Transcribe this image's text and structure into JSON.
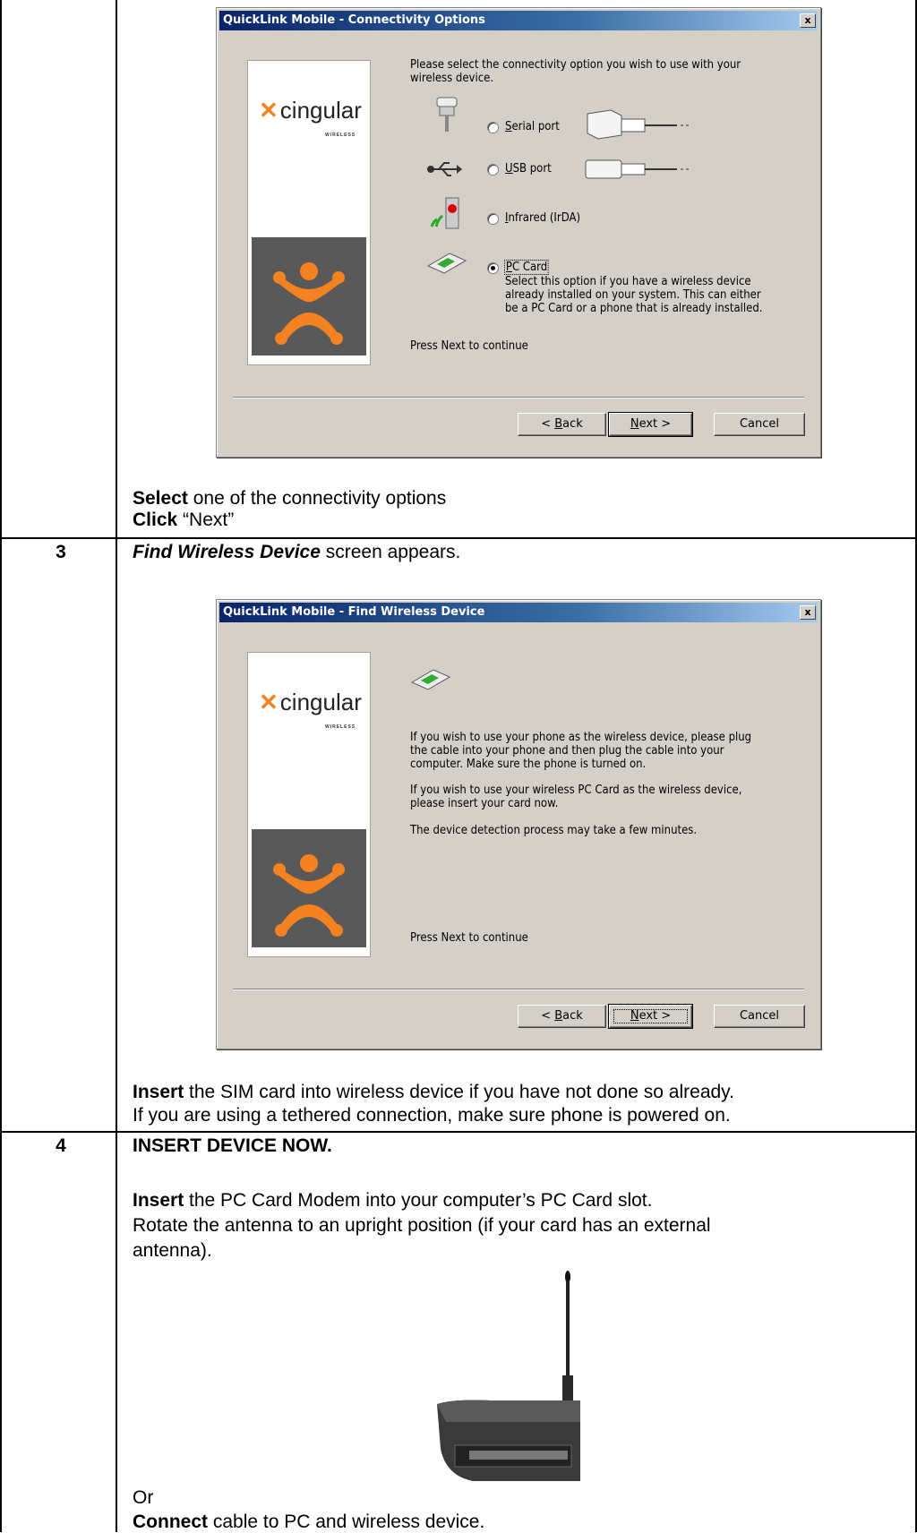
{
  "dialog1": {
    "title": "QuickLink Mobile - Connectivity Options",
    "close": "x",
    "brand": "cingular",
    "brand_sub": "WIRELESS",
    "instruction_line1": "Please select the connectivity option you wish to use with your",
    "instruction_line2": "wireless device.",
    "options": [
      {
        "key": "S",
        "rest": "erial port",
        "selected": false
      },
      {
        "key": "U",
        "rest": "SB port",
        "selected": false
      },
      {
        "key": "I",
        "rest": "nfrared (IrDA)",
        "selected": false
      },
      {
        "key": "P",
        "rest": "C Card",
        "selected": true
      }
    ],
    "pccard_desc": [
      "Select this option if you have a wireless device",
      "already installed on your system. This can either",
      "be a PC Card or a phone that is already installed."
    ],
    "footer": "Press Next to continue",
    "buttons": {
      "back_key": "B",
      "back_pre": "< ",
      "back_rest": "ack",
      "next_key": "N",
      "next_rest": "ext >",
      "cancel": "Cancel"
    }
  },
  "step2_text": {
    "line1_bold": "Select",
    "line1_rest": " one of the connectivity options",
    "line2_bold": "Click",
    "line2_rest": " “Next”"
  },
  "step3": {
    "number": "3",
    "heading_bold": "Find Wireless Device",
    "heading_rest": " screen appears."
  },
  "dialog2": {
    "title": "QuickLink Mobile - Find Wireless Device",
    "close": "x",
    "brand": "cingular",
    "brand_sub": "WIRELESS",
    "para1": [
      "If you wish to use your phone as the wireless device, please plug",
      "the cable into your phone and then plug the cable into your",
      "computer.  Make sure the phone is turned on."
    ],
    "para2": [
      "If you wish to use your wireless PC Card as the wireless device,",
      "please insert your card now."
    ],
    "para3": "The device detection process may take a few minutes.",
    "footer": "Press Next to continue",
    "buttons": {
      "back_key": "B",
      "back_pre": "< ",
      "back_rest": "ack",
      "next_key": "N",
      "next_rest": "ext >",
      "cancel": "Cancel"
    }
  },
  "step3_text": {
    "line1_bold": "Insert",
    "line1_rest": " the SIM card into wireless device if you have not done so already.",
    "line2": "If you are using a tethered connection, make sure phone is powered on."
  },
  "step4": {
    "number": "4",
    "heading": "INSERT DEVICE NOW.",
    "line1_bold": "Insert",
    "line1_rest": " the PC Card Modem into your computer’s PC Card slot.",
    "line2": "Rotate the antenna to an upright position (if your card has an external",
    "line3": "antenna).",
    "or": "Or",
    "line4_bold": "Connect",
    "line4_rest": " cable to PC and wireless device."
  },
  "colors": {
    "accent_orange": "#f58220",
    "dialog_bg": "#d4d0c8",
    "title_blue": "#0a246a"
  }
}
